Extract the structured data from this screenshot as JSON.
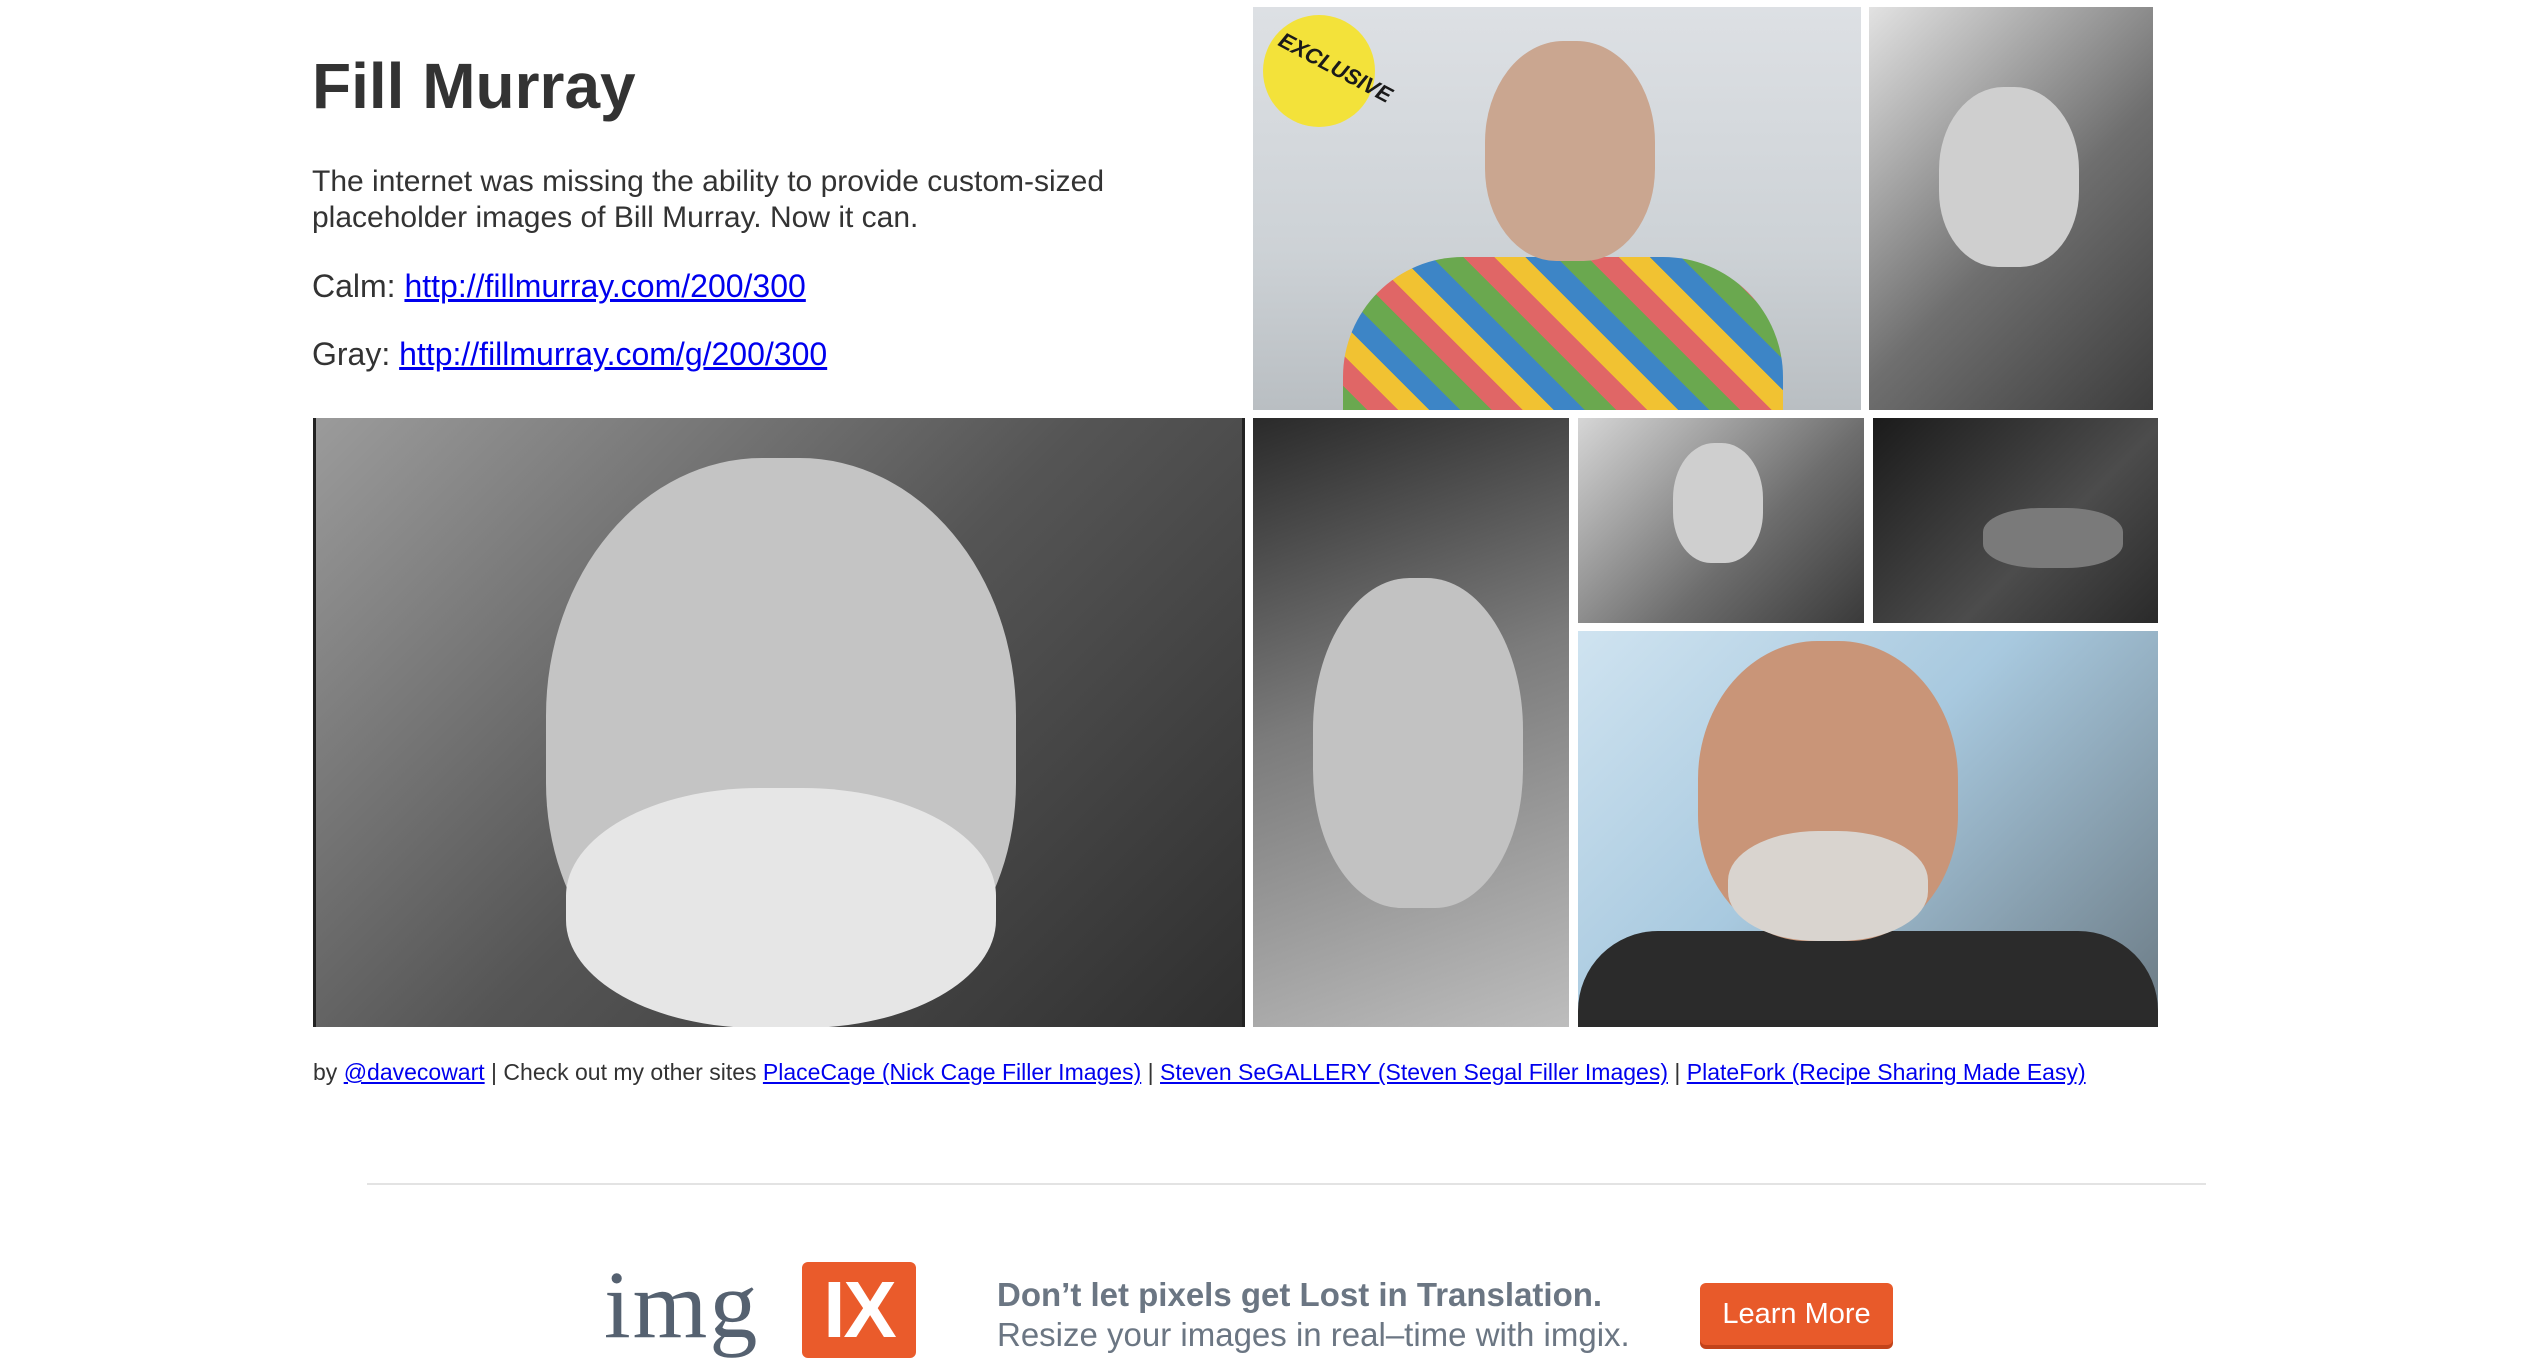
{
  "header": {
    "title": "Fill Murray",
    "description": "The internet was missing the ability to provide custom-sized placeholder images of Bill Murray. Now it can.",
    "calm_label": "Calm:",
    "calm_link": "http://fillmurray.com/200/300",
    "gray_label": "Gray:",
    "gray_link": "http://fillmurray.com/g/200/300"
  },
  "gallery": {
    "sticker_text": "EXCLUSIVE"
  },
  "credits": {
    "by": "by",
    "author_link": "@davecowart",
    "separator1": " | Check out my other sites ",
    "site1": "PlaceCage (Nick Cage Filler Images)",
    "separator2": " | ",
    "site2": "Steven SeGALLERY (Steven Segal Filler Images)",
    "separator3": " | ",
    "site3": "PlateFork (Recipe Sharing Made Easy)"
  },
  "ad": {
    "logo_text": "img",
    "logo_badge": "IX",
    "headline": "Don’t let pixels get Lost in Translation.",
    "subline": "Resize your images in real–time with imgix.",
    "button_label": "Learn More",
    "brand_color": "#ea5b2b"
  }
}
